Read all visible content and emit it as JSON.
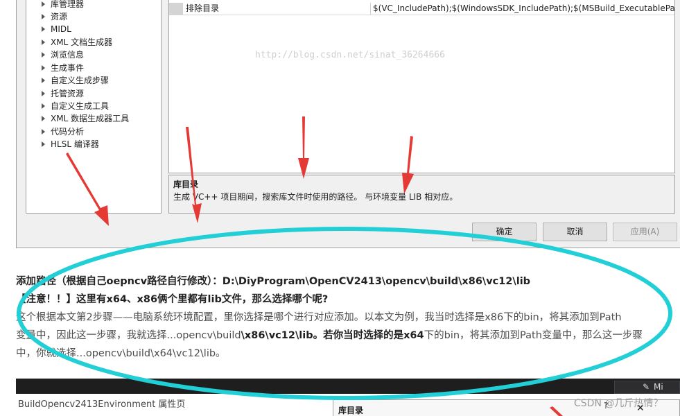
{
  "tree": {
    "items": [
      "库管理器",
      "资源",
      "MIDL",
      "XML 文档生成器",
      "浏览信息",
      "生成事件",
      "自定义生成步骤",
      "托管资源",
      "自定义生成工具",
      "XML 数据生成器工具",
      "代码分析",
      "HLSL 编译器"
    ]
  },
  "grid": {
    "row_name": "排除目录",
    "row_value": "$(VC_IncludePath);$(WindowsSDK_IncludePath);$(MSBuild_ExecutablePa"
  },
  "watermark": "http://blog.csdn.net/sinat_36264666",
  "description": {
    "title": "库目录",
    "text": "生成 VC++ 项目期间，搜索库文件时使用的路径。 与环境变量 LIB 相对应。"
  },
  "buttons": {
    "ok": "确定",
    "cancel": "取消",
    "apply": "应用(A)"
  },
  "article": {
    "line1": "添加路径（根据自己oepncv路径自行修改）：D:\\DiyProgram\\OpenCV2413\\opencv\\build\\x86\\vc12\\lib",
    "line2": "【注意！！】这里有x64、x86俩个里都有lib文件，那么选择哪个呢?",
    "p1": "这个根据本文第2步骤——电脑系统环境配置，里你选择是哪个进行对应添加。以本文为例，我当时选择是x86下的bin，将其添加到Path",
    "p2a": "变量中，因此这一步骤，我就选择...opencv\\build",
    "p2b": "\\x86\\vc12\\lib。若你当时选择的是x64",
    "p2c": "下的bin，将其添加到Path变量中，那么这一步骤",
    "p3": "中，你就选择...opencv\\build\\x64\\vc12\\lib。"
  },
  "bottom": {
    "window_title": "BuildOpencv2413Environment 属性页",
    "inner_title": "库目录",
    "help": "?",
    "close": "✕",
    "dark_tab": "Mi"
  },
  "csdn_watermark": "CSDN @几斤热情？",
  "colors": {
    "arrow": "#e53935",
    "ellipse": "#22cfd6"
  }
}
